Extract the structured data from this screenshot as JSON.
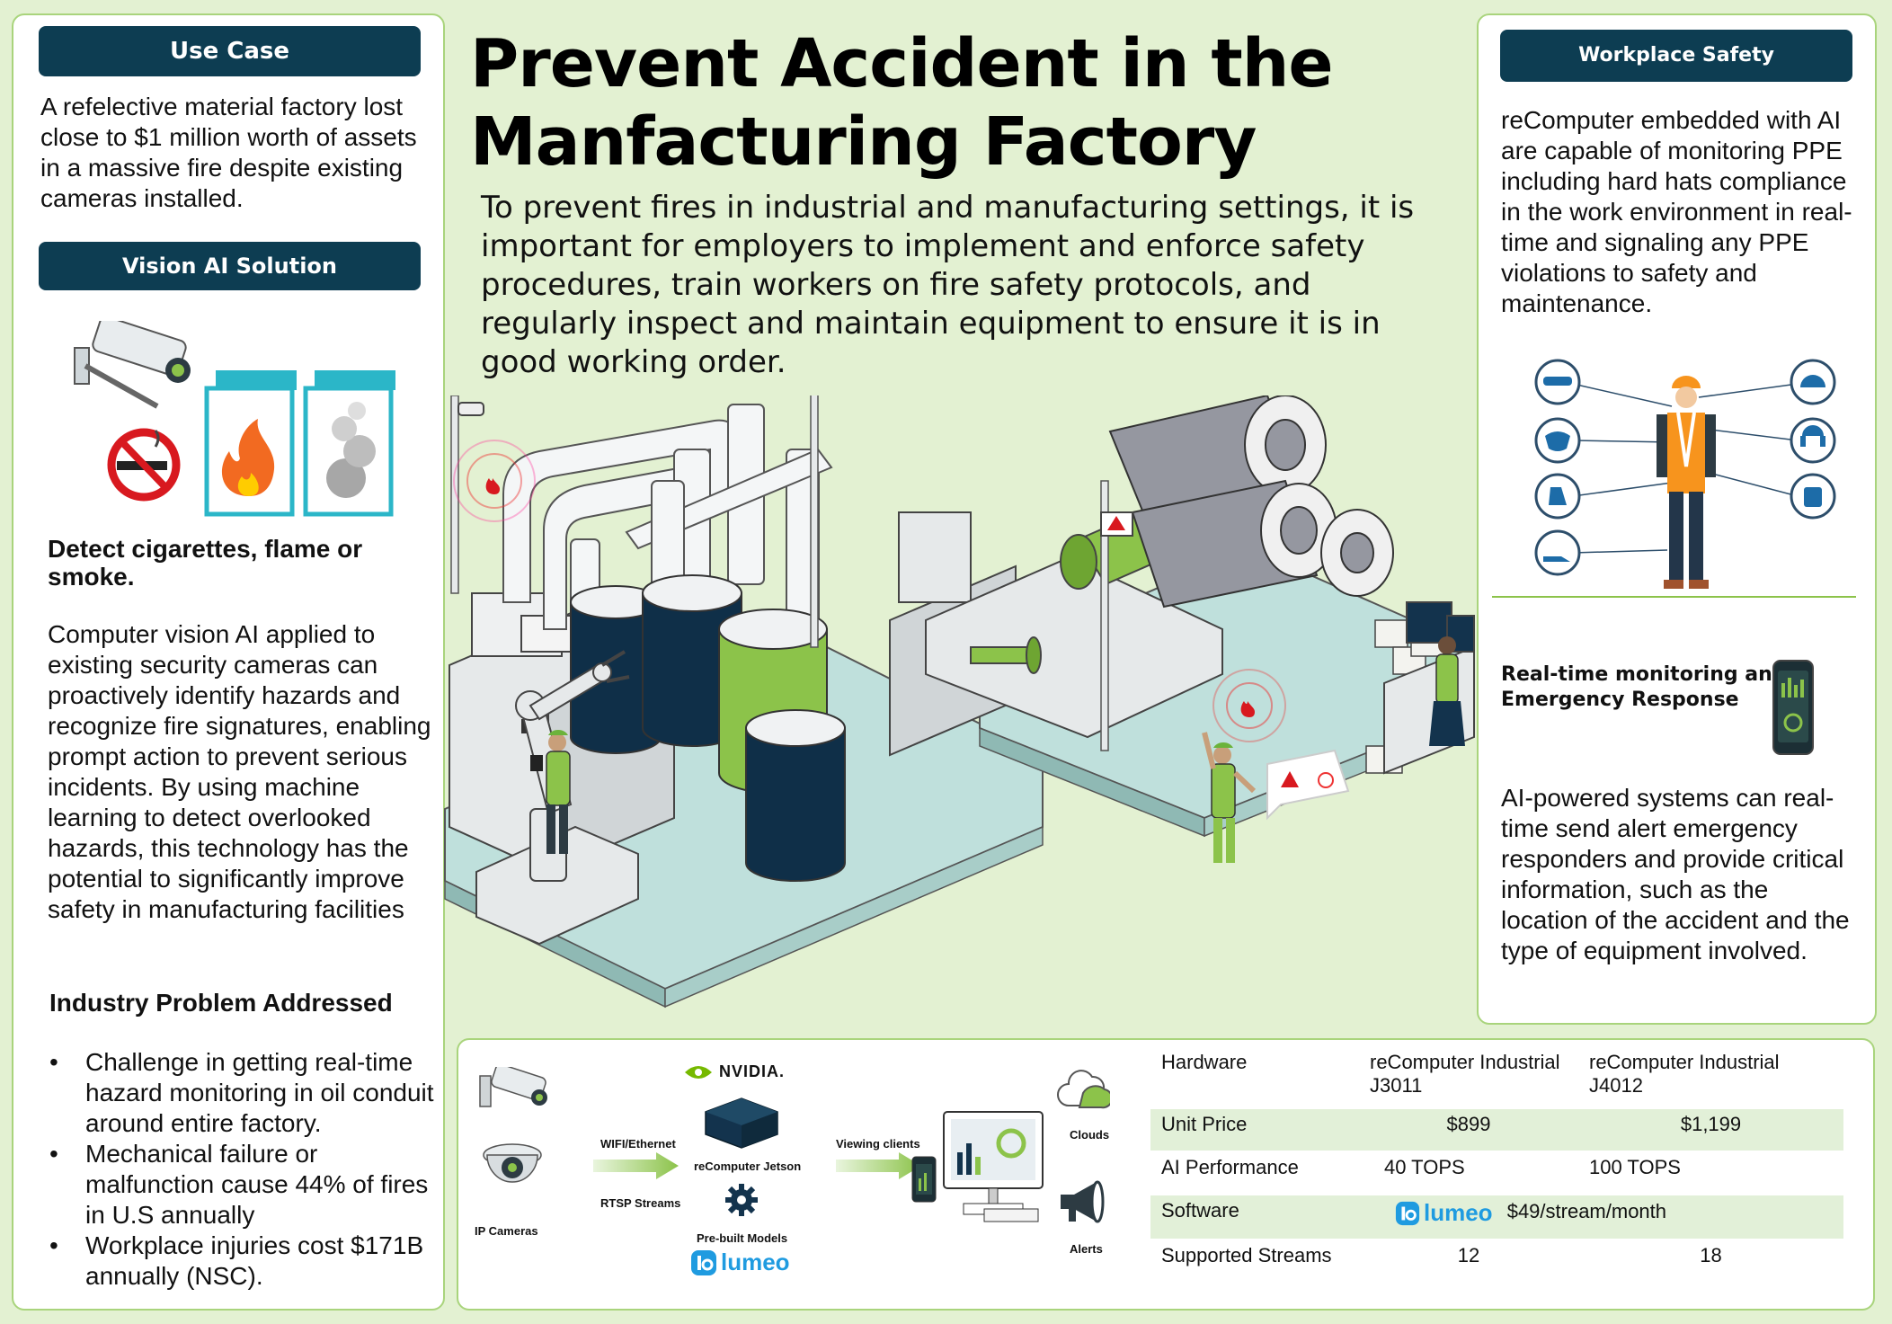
{
  "title": {
    "line1": "Prevent Accident in the",
    "line2": "Manfacturing Factory"
  },
  "intro": "To prevent fires in industrial and manufacturing settings, it is important for employers to implement and enforce safety procedures, train workers on fire safety protocols, and regularly inspect and maintain equipment to ensure it is in good working order.",
  "left": {
    "use_case_label": "Use Case",
    "use_case_text": "A refelective material factory lost close to $1 million worth of assets in a massive fire despite existing cameras installed.",
    "vision_label": "Vision AI Solution",
    "detect_heading": "Detect cigarettes, flame or smoke.",
    "vision_text": "Computer vision AI applied to existing security cameras can proactively identify hazards and recognize fire signatures, enabling prompt action to prevent serious incidents. By using machine learning to detect overlooked hazards, this technology has the potential to significantly improve safety in manufacturing facilities",
    "problem_heading": "Industry Problem Addressed",
    "problems": [
      "Challenge in getting real-time hazard monitoring in oil conduit around entire factory.",
      "Mechanical failure or malfunction cause 44% of fires in U.S annually",
      "Workplace injuries cost $171B annually (NSC)."
    ]
  },
  "right": {
    "safety_label": "Workplace Safety",
    "safety_text": "reComputer embedded with AI are capable of monitoring PPE including hard hats compliance in the work environment in real-time and signaling any PPE violations to safety and maintenance.",
    "rt_heading": "Real-time monitoring and Emergency Response",
    "rt_text": "AI-powered systems can real-time send  alert emergency responders and provide critical information, such as the location of the accident and the type of equipment involved."
  },
  "pipeline": {
    "ip_cameras": "IP Cameras",
    "wifi": "WIFI/Ethernet",
    "rtsp": "RTSP Streams",
    "nvidia": "NVIDIA.",
    "jetson": "reComputer Jetson",
    "models": "Pre-built Models",
    "lumeo": "lumeo",
    "viewing": "Viewing clients",
    "clouds": "Clouds",
    "alerts": "Alerts"
  },
  "table": {
    "rows": [
      {
        "label": "Hardware",
        "a": "reComputer Industrial  J3011",
        "b": "reComputer Industrial J4012"
      },
      {
        "label": "Unit Price",
        "a": "$899",
        "b": "$1,199"
      },
      {
        "label": "AI Performance",
        "a": "40 TOPS",
        "b": "100 TOPS"
      },
      {
        "label": "Software",
        "lumeo": "lumeo",
        "price": "$49/stream/month"
      },
      {
        "label": "Supported Streams",
        "a": "12",
        "b": "18"
      }
    ]
  },
  "colors": {
    "background": "#e3f1d2",
    "navy": "#0d3d52",
    "accent_green": "#8cc34a",
    "table_shade": "#e2f0d8",
    "lumeo_blue": "#1f9be0"
  }
}
